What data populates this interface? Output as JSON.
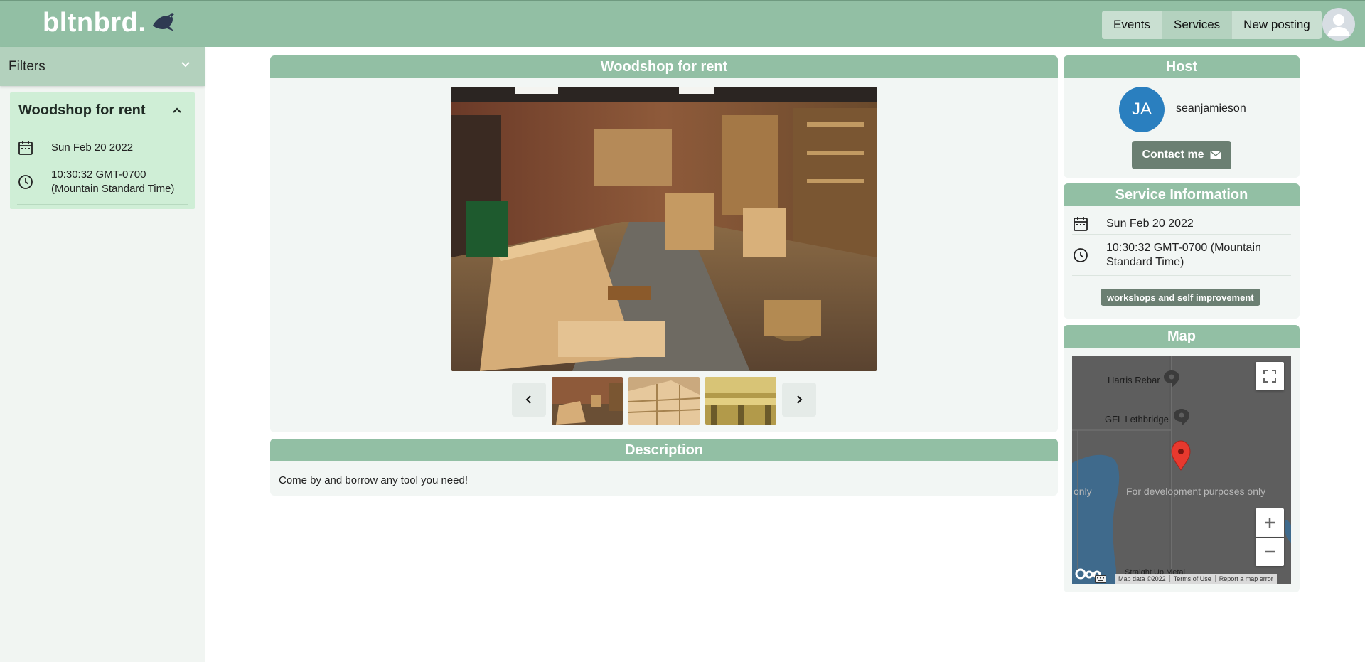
{
  "app": {
    "logo_text": "bltnbrd."
  },
  "nav": {
    "items": [
      {
        "label": "Events"
      },
      {
        "label": "Services"
      },
      {
        "label": "New posting"
      }
    ]
  },
  "sidebar": {
    "filters_label": "Filters",
    "listing": {
      "title": "Woodshop for rent",
      "date": "Sun Feb 20 2022",
      "time": "10:30:32 GMT-0700 (Mountain Standard Time)"
    }
  },
  "gallery": {
    "title": "Woodshop for rent",
    "prev_icon": "chevron-left-icon",
    "next_icon": "chevron-right-icon",
    "thumbnail_count": 3
  },
  "description": {
    "title": "Description",
    "text": "Come by and borrow any tool you need!"
  },
  "host": {
    "title": "Host",
    "initials": "JA",
    "username": "seanjamieson",
    "contact_label": "Contact me"
  },
  "service_info": {
    "title": "Service Information",
    "date": "Sun Feb 20 2022",
    "time": "10:30:32 GMT-0700 (Mountain Standard Time)",
    "tag": "workshops and self improvement"
  },
  "map": {
    "title": "Map",
    "labels": [
      "Harris Rebar",
      "GFL Lethbridge",
      "Straight Up Metal"
    ],
    "watermark": "For development purposes only",
    "watermark_left": "only",
    "footer": [
      "Map data ©2022",
      "Terms of Use",
      "Report a map error"
    ],
    "colors": {
      "water": "#3f6a8c",
      "land": "#5e5e5e",
      "pin": "#e8392e"
    }
  },
  "colors": {
    "accent": "#92bfa4",
    "panel": "#f2f6f4",
    "button": "#6b7f72",
    "listing": "#cfeed6"
  }
}
